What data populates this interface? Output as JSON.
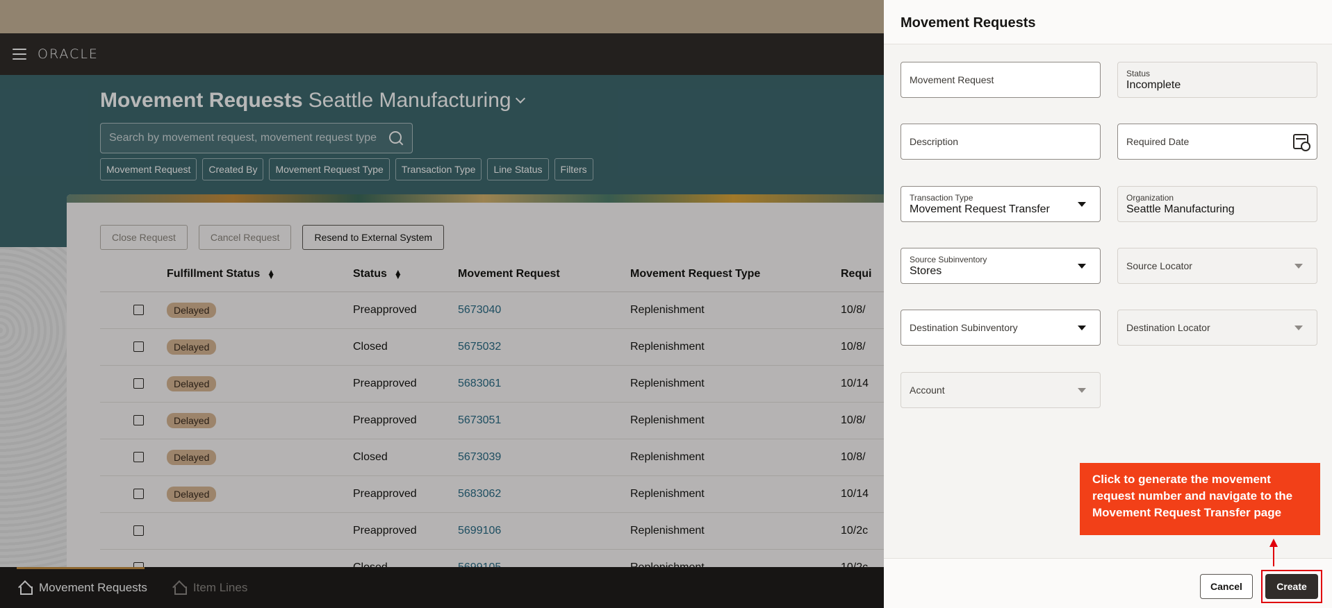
{
  "brand": {
    "logo": "ORACLE",
    "menu_icon": "hamburger-icon"
  },
  "page": {
    "title": "Movement Requests",
    "organization": "Seattle Manufacturing"
  },
  "search": {
    "placeholder": "Search by movement request, movement request type"
  },
  "filter_chips": [
    "Movement Request",
    "Created By",
    "Movement Request Type",
    "Transaction Type",
    "Line Status",
    "Filters"
  ],
  "actions": {
    "close_request": "Close Request",
    "cancel_request": "Cancel Request",
    "resend": "Resend to External System"
  },
  "table": {
    "headers": {
      "fulfillment_status": "Fulfillment Status",
      "status": "Status",
      "movement_request": "Movement Request",
      "movement_request_type": "Movement Request Type",
      "required": "Requi"
    },
    "rows": [
      {
        "fulfillment": "Delayed",
        "status": "Preapproved",
        "request": "5673040",
        "type": "Replenishment",
        "date": "10/8/"
      },
      {
        "fulfillment": "Delayed",
        "status": "Closed",
        "request": "5675032",
        "type": "Replenishment",
        "date": "10/8/"
      },
      {
        "fulfillment": "Delayed",
        "status": "Preapproved",
        "request": "5683061",
        "type": "Replenishment",
        "date": "10/14"
      },
      {
        "fulfillment": "Delayed",
        "status": "Preapproved",
        "request": "5673051",
        "type": "Replenishment",
        "date": "10/8/"
      },
      {
        "fulfillment": "Delayed",
        "status": "Closed",
        "request": "5673039",
        "type": "Replenishment",
        "date": "10/8/"
      },
      {
        "fulfillment": "Delayed",
        "status": "Preapproved",
        "request": "5683062",
        "type": "Replenishment",
        "date": "10/14"
      },
      {
        "fulfillment": "",
        "status": "Preapproved",
        "request": "5699106",
        "type": "Replenishment",
        "date": "10/2c"
      },
      {
        "fulfillment": "",
        "status": "Closed",
        "request": "5699105",
        "type": "Replenishment",
        "date": "10/2c"
      }
    ]
  },
  "bottom_nav": {
    "movement_requests": "Movement Requests",
    "item_lines": "Item Lines"
  },
  "drawer": {
    "title": "Movement Requests",
    "fields": {
      "movement_request": {
        "placeholder": "Movement Request"
      },
      "status": {
        "label": "Status",
        "value": "Incomplete"
      },
      "description": {
        "placeholder": "Description"
      },
      "required_date": {
        "placeholder": "Required Date"
      },
      "transaction_type": {
        "label": "Transaction Type",
        "value": "Movement Request Transfer"
      },
      "organization": {
        "label": "Organization",
        "value": "Seattle Manufacturing"
      },
      "source_subinventory": {
        "label": "Source Subinventory",
        "value": "Stores"
      },
      "source_locator": {
        "placeholder": "Source Locator"
      },
      "destination_subinventory": {
        "placeholder": "Destination Subinventory"
      },
      "destination_locator": {
        "placeholder": "Destination Locator"
      },
      "account": {
        "placeholder": "Account"
      }
    },
    "cancel": "Cancel",
    "create": "Create"
  },
  "callout": {
    "text": "Click to generate the movement request number and navigate to the Movement Request Transfer page"
  },
  "colors": {
    "hero": "#3f6a70",
    "brandbar": "#312d2a",
    "callout": "#f24018",
    "highlight": "#e0000b",
    "badge": "#d8b795",
    "link": "#2a6c87"
  }
}
